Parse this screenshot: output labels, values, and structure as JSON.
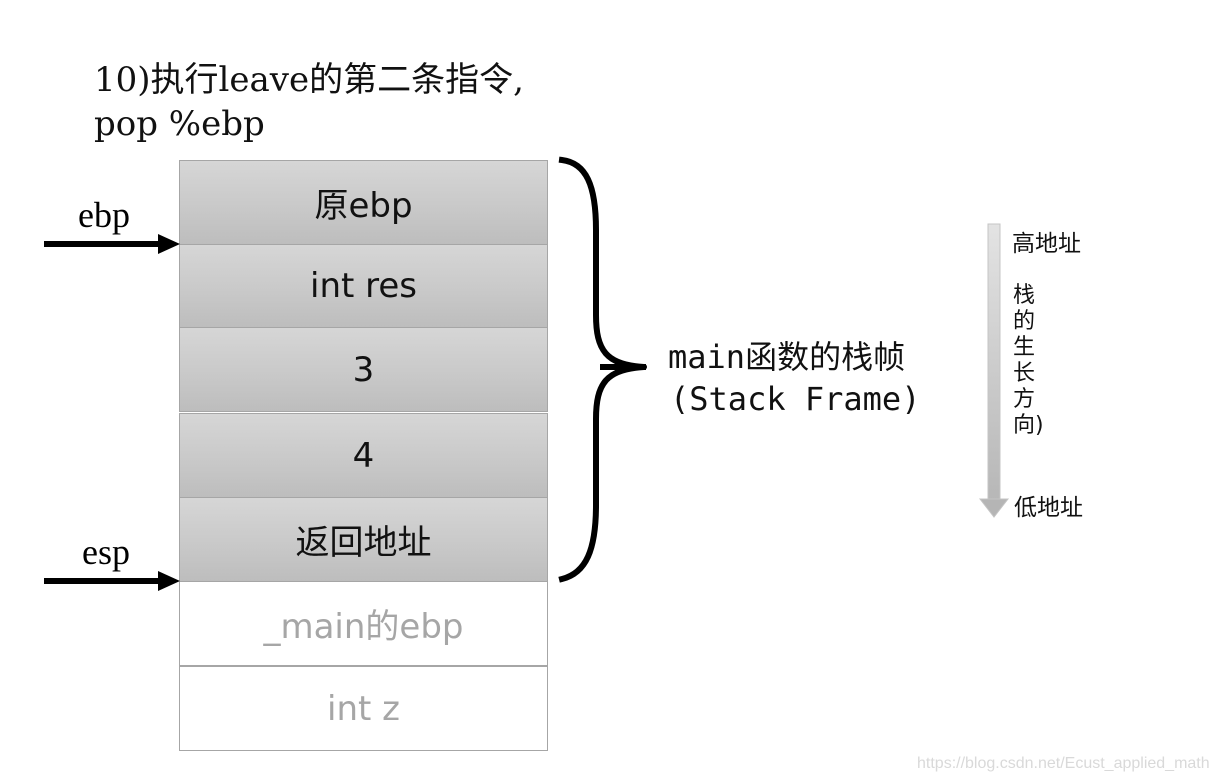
{
  "heading": {
    "line1": "10)执行leave的第二条指令,",
    "line2": "pop %ebp"
  },
  "registers": {
    "ebp": "ebp",
    "esp": "esp"
  },
  "stack": {
    "frame_cells": [
      {
        "label": "原ebp"
      },
      {
        "label": "int res"
      },
      {
        "label": "3"
      },
      {
        "label": "4"
      },
      {
        "label": "返回地址"
      }
    ],
    "outer_cells": [
      {
        "label": "_main的ebp"
      },
      {
        "label": "int z"
      }
    ]
  },
  "frame_annotation": {
    "line1": "main函数的栈帧",
    "line2": "(Stack Frame)"
  },
  "growth": {
    "high_label": "高地址",
    "direction_label": "栈的生长方向)",
    "low_label": "低地址"
  },
  "watermark": "https://blog.csdn.net/Ecust_applied_math",
  "colors": {
    "cell_fill": "#c9c9c9",
    "cell_border": "#a6a6a6",
    "faded_text": "#a6a6a6",
    "arrow": "#000000"
  }
}
